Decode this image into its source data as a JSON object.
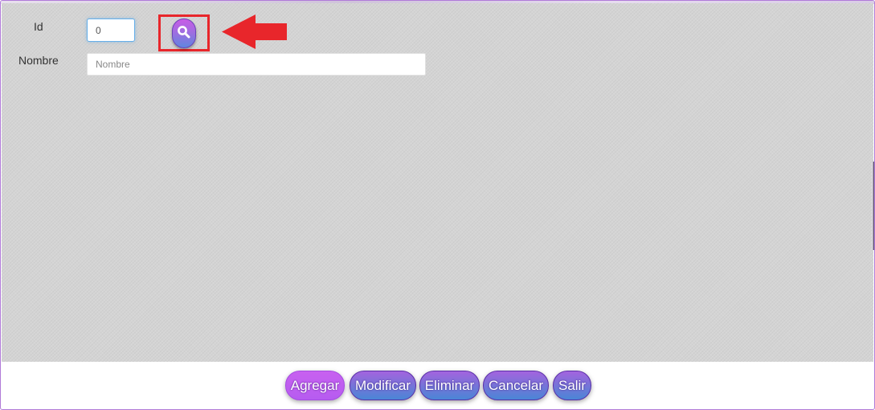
{
  "form": {
    "id_label": "Id",
    "id_value": "0",
    "nombre_label": "Nombre",
    "nombre_placeholder": "Nombre",
    "nombre_value": ""
  },
  "search": {
    "icon": "search-icon"
  },
  "annotation": {
    "highlight_color": "#e8262b",
    "arrow_color": "#e8262b"
  },
  "toolbar": {
    "buttons": [
      {
        "label": "Agregar"
      },
      {
        "label": "Modificar"
      },
      {
        "label": "Eliminar"
      },
      {
        "label": "Cancelar"
      },
      {
        "label": "Salir"
      }
    ]
  },
  "colors": {
    "form_background": "#d4d4d4",
    "button_gradient_top": "#a364df",
    "button_gradient_bottom": "#4a86d6",
    "agregar_color": "#c861f0"
  }
}
